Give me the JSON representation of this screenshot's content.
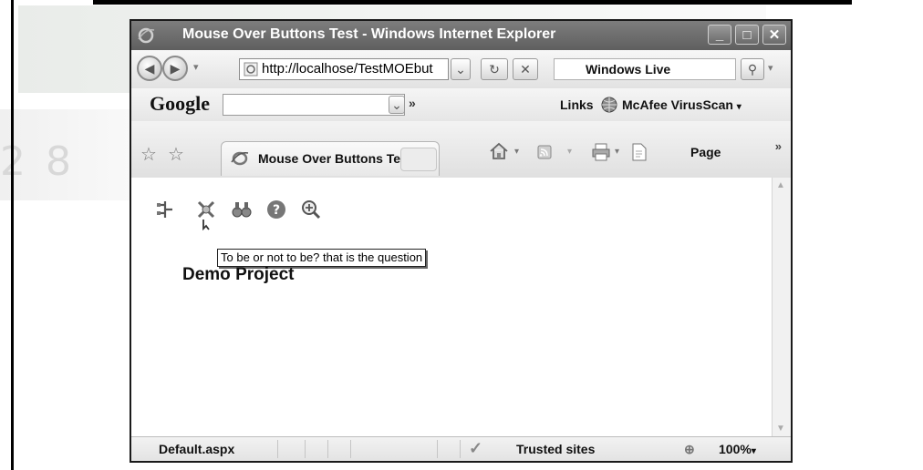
{
  "window": {
    "title": "Mouse Over Buttons Test - Windows Internet Explorer",
    "controls": {
      "minimize": "_",
      "maximize": "□",
      "close": "✕"
    }
  },
  "address_bar": {
    "url": "http://localhose/TestMOEbut",
    "search_provider": "Windows Live"
  },
  "google_toolbar": {
    "logo": "Google",
    "search_value": "",
    "more": "»",
    "links_label": "Links",
    "mcafee_label": "McAfee VirusScan"
  },
  "command_bar": {
    "tab_title": "Mouse Over Buttons Test",
    "page_label": "Page",
    "overflow": "»"
  },
  "content": {
    "icons": [
      "tree-icon",
      "tools-icon",
      "binoculars-icon",
      "help-icon",
      "zoom-icon"
    ],
    "tooltip": "To be or not to be? that is the question",
    "heading": "Demo Project"
  },
  "status_bar": {
    "page": "Default.aspx",
    "zone": "Trusted sites",
    "zoom": "100%"
  },
  "colors": {
    "titlebar": "#6e6e6e",
    "chrome": "#e6e6e6"
  }
}
